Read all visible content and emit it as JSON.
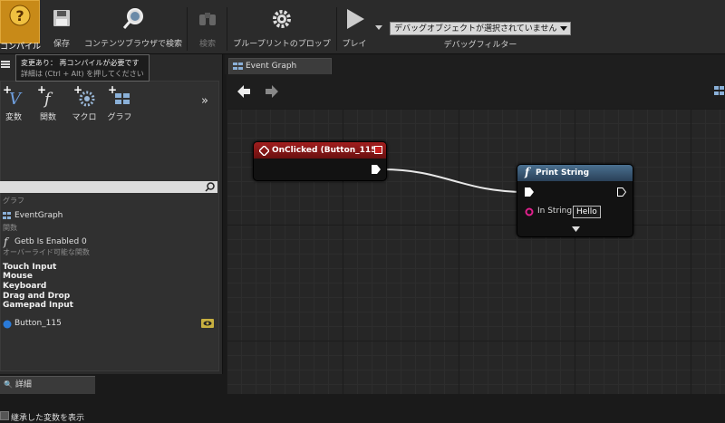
{
  "toolbar": {
    "compile_label": "コンパイル",
    "save_label": "保存",
    "browse_label": "コンテンツブラウザで検索",
    "search_label": "検索",
    "props_label": "ブループリントのプロップ",
    "play_label": "プレイ",
    "debug_value": "デバッグオブジェクトが選択されていません",
    "debug_label": "デバッグフィルター"
  },
  "tooltip": {
    "line1": "変更あり： 再コンパイルが必要です",
    "line2": "詳細は (Ctrl + Alt) を押してください"
  },
  "left_panel": {
    "add_buttons": [
      "変数",
      "関数",
      "マクロ",
      "グラフ"
    ],
    "graph_section": "グラフ",
    "event_graph": "EventGraph",
    "functions_section": "関数",
    "function_item": "Getb Is Enabled 0",
    "override_label": "オーバーライド可能な関数",
    "input_events": [
      "Touch Input",
      "Mouse",
      "Keyboard",
      "Drag and Drop",
      "Gamepad Input"
    ],
    "variable": "Button_115",
    "show_inherited": "継承した変数を表示"
  },
  "details_tab": "詳細",
  "graph": {
    "tab_label": "Event Graph",
    "event_node_title": "OnClicked (Button_115)",
    "print_node_title": "Print String",
    "in_string_label": "In String",
    "in_string_value": "Hello"
  },
  "colors": {
    "compile_bg": "#c88a18",
    "event_header": "#8a1a1a",
    "function_header": "#3a5a7a",
    "string_pin": "#e0208c",
    "variable_dot": "#2a7ad8"
  }
}
